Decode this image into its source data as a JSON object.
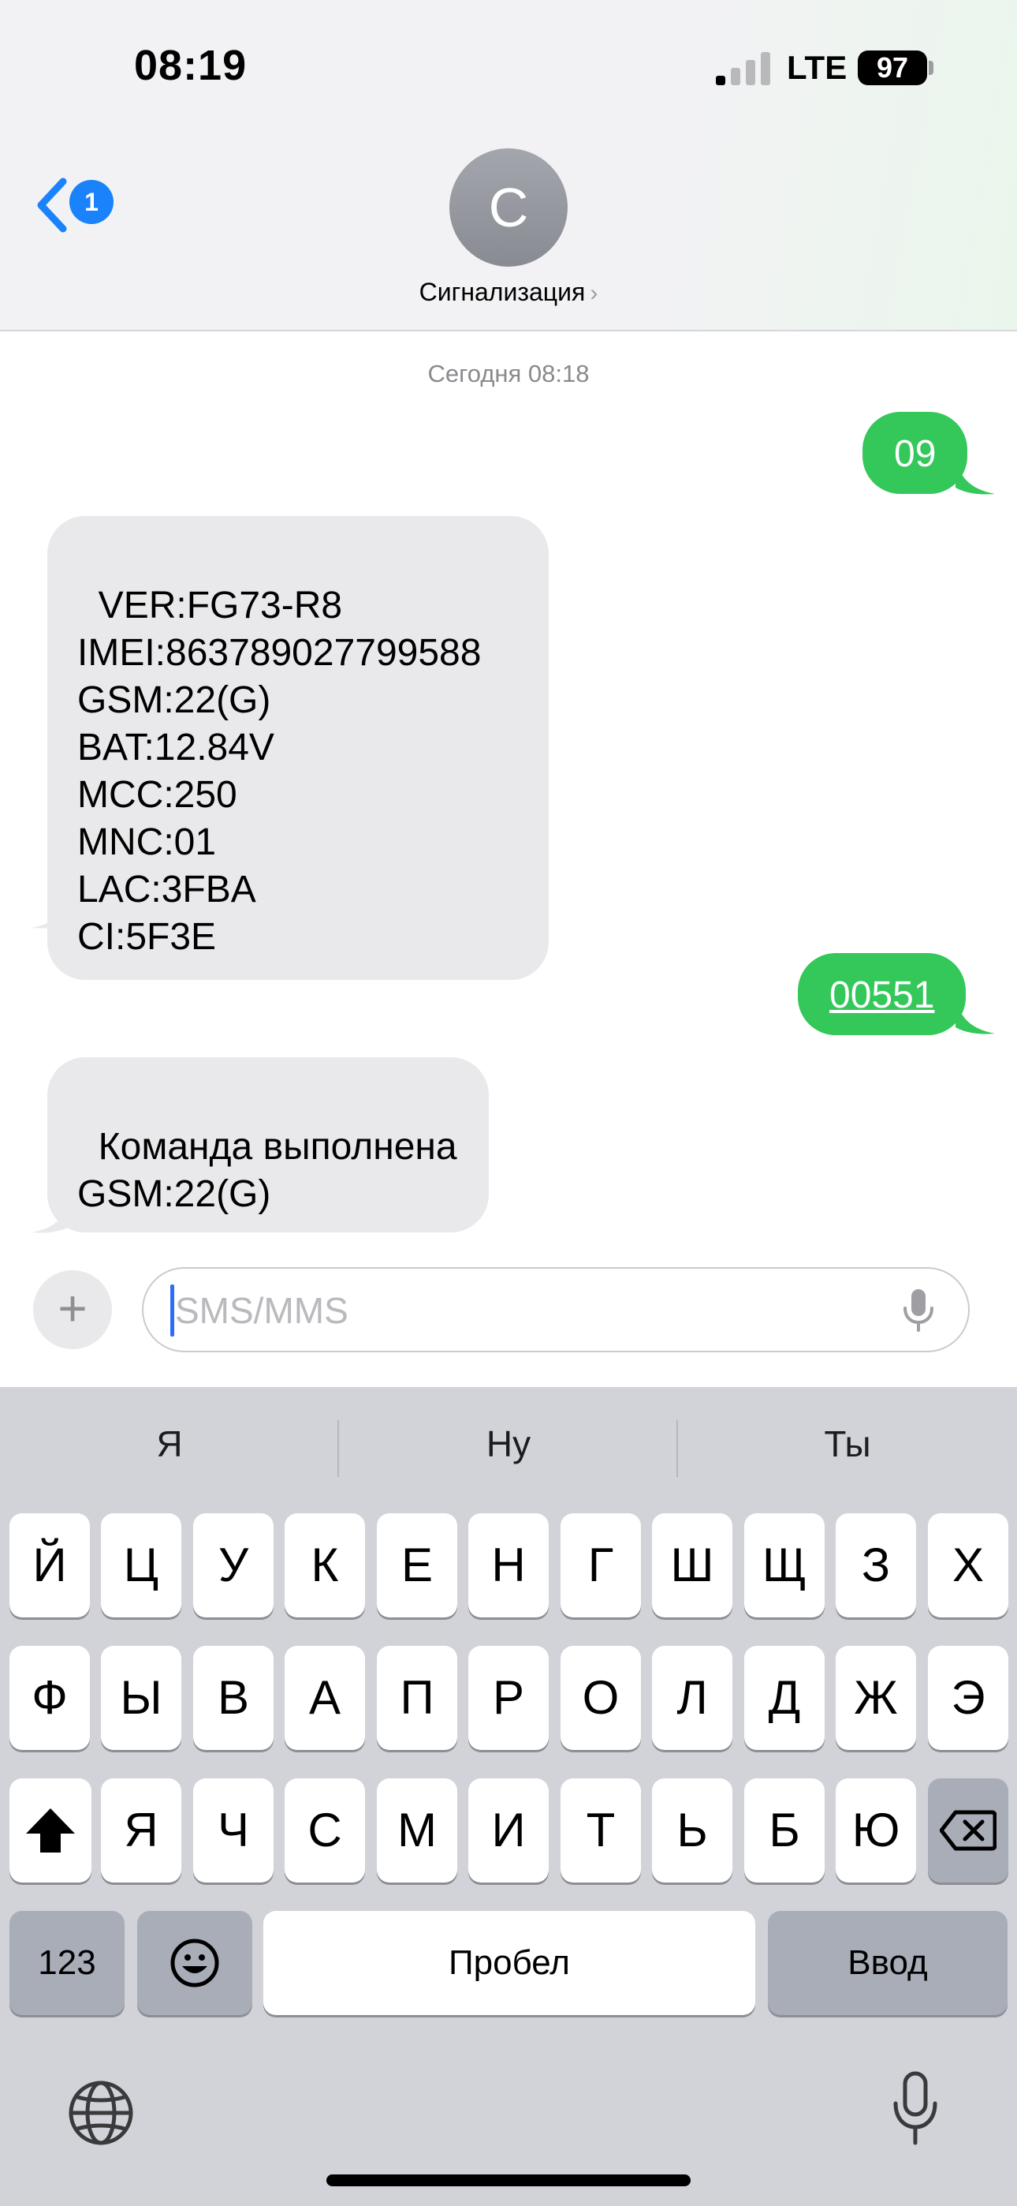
{
  "status_bar": {
    "time": "08:19",
    "network": "LTE",
    "battery": "97"
  },
  "header": {
    "back_badge": "1",
    "avatar_letter": "С",
    "contact_name": "Сигнализация",
    "chevron": "›"
  },
  "conversation": {
    "timestamp": "Сегодня 08:18",
    "messages": [
      {
        "direction": "outgoing",
        "text": "09"
      },
      {
        "direction": "incoming",
        "text": "VER:FG73-R8\nIMEI:863789027799588\nGSM:22(G)\nBAT:12.84V\nMCC:250\nMNC:01\nLAC:3FBA\nCI:5F3E"
      },
      {
        "direction": "outgoing",
        "text": "00551"
      },
      {
        "direction": "incoming",
        "text": "Команда выполнена\nGSM:22(G)"
      }
    ]
  },
  "composer": {
    "plus": "+",
    "placeholder": "SMS/MMS",
    "value": ""
  },
  "keyboard": {
    "suggestions": [
      "Я",
      "Ну",
      "Ты"
    ],
    "row1": [
      "Й",
      "Ц",
      "У",
      "К",
      "Е",
      "Н",
      "Г",
      "Ш",
      "Щ",
      "З",
      "Х"
    ],
    "row2": [
      "Ф",
      "Ы",
      "В",
      "А",
      "П",
      "Р",
      "О",
      "Л",
      "Д",
      "Ж",
      "Э"
    ],
    "row3": [
      "Я",
      "Ч",
      "С",
      "М",
      "И",
      "Т",
      "Ь",
      "Б",
      "Ю"
    ],
    "numbers_label": "123",
    "space_label": "Пробел",
    "return_label": "Ввод"
  },
  "icons": [
    "back-chevron-icon",
    "cellular-signal-icon",
    "battery-icon",
    "plus-icon",
    "microphone-icon",
    "shift-icon",
    "backspace-icon",
    "emoji-icon",
    "globe-icon"
  ],
  "colors": {
    "outgoing_bubble": "#34c759",
    "incoming_bubble": "#e9e9eb",
    "accent": "#1a82fb",
    "keyboard_bg": "#d1d3d9"
  }
}
